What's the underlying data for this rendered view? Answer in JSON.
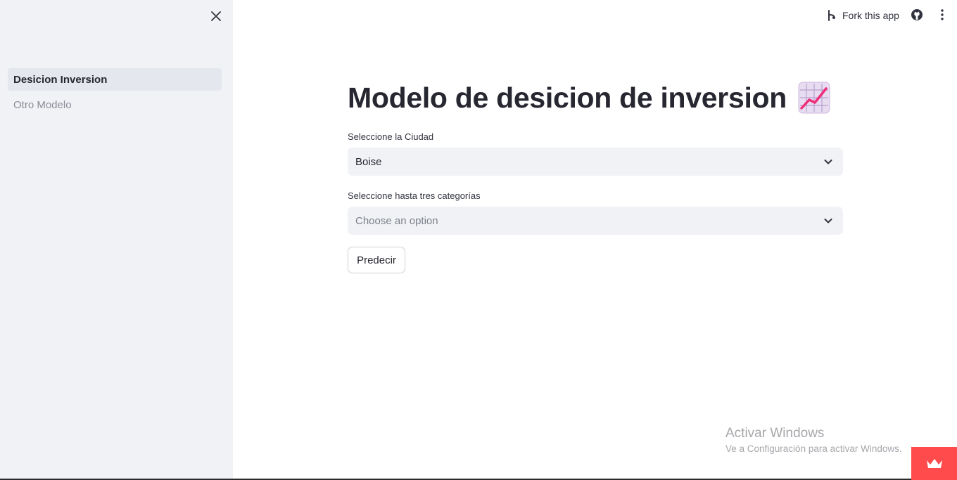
{
  "sidebar": {
    "close_icon": "close-icon",
    "items": [
      {
        "label": "Desicion Inversion",
        "active": true
      },
      {
        "label": "Otro Modelo",
        "active": false
      }
    ]
  },
  "toolbar": {
    "fork_label": "Fork this app",
    "fork_icon": "fork-icon",
    "github_icon": "github-icon",
    "menu_icon": "kebab-menu-icon"
  },
  "main": {
    "title": "Modelo de desicion de inversion",
    "title_icon": "chart-increasing-icon",
    "city_select": {
      "label": "Seleccione la Ciudad",
      "value": "Boise"
    },
    "category_select": {
      "label": "Seleccione hasta tres categorías",
      "placeholder": "Choose an option"
    },
    "predict_button": "Predecir"
  },
  "watermark": {
    "title": "Activar Windows",
    "subtitle": "Ve a Configuración para activar Windows."
  },
  "colors": {
    "sidebar_bg": "#f0f2f6",
    "accent": "#ff4b4b",
    "text": "#262730"
  }
}
